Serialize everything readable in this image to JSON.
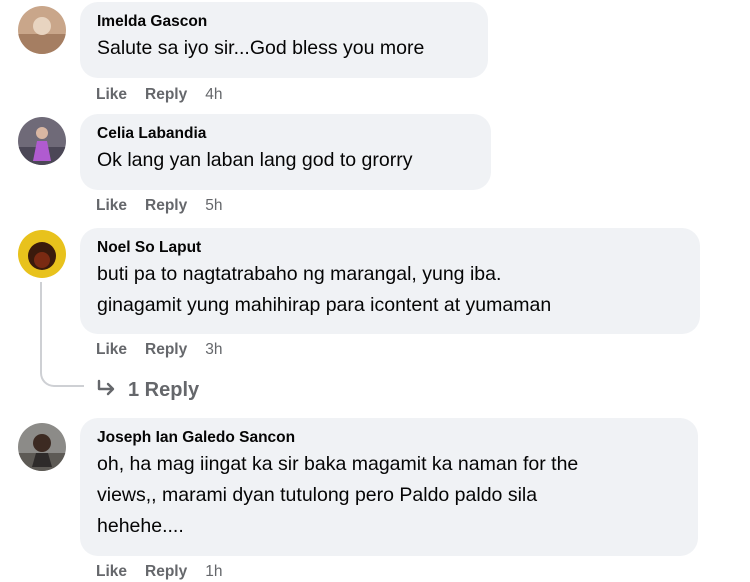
{
  "comments": [
    {
      "author": "Imelda Gascon",
      "lines": [
        "Salute sa iyo sir...God bless you more"
      ],
      "like": "Like",
      "reply": "Reply",
      "time": "4h"
    },
    {
      "author": "Celia Labandia",
      "lines": [
        "Ok lang yan laban lang god to grorry"
      ],
      "like": "Like",
      "reply": "Reply",
      "time": "5h"
    },
    {
      "author": "Noel So Laput",
      "lines": [
        "buti pa to nagtatrabaho ng marangal, yung iba.",
        "ginagamit yung mahihirap para icontent at yumaman"
      ],
      "like": "Like",
      "reply": "Reply",
      "time": "3h",
      "replies_label": "1 Reply"
    },
    {
      "author": "Joseph Ian Galedo Sancon",
      "lines": [
        "oh, ha mag iingat ka sir baka magamit ka naman for the",
        "views,, marami dyan tutulong pero Paldo paldo sila",
        "hehehe...."
      ],
      "like": "Like",
      "reply": "Reply",
      "time": "1h"
    }
  ]
}
